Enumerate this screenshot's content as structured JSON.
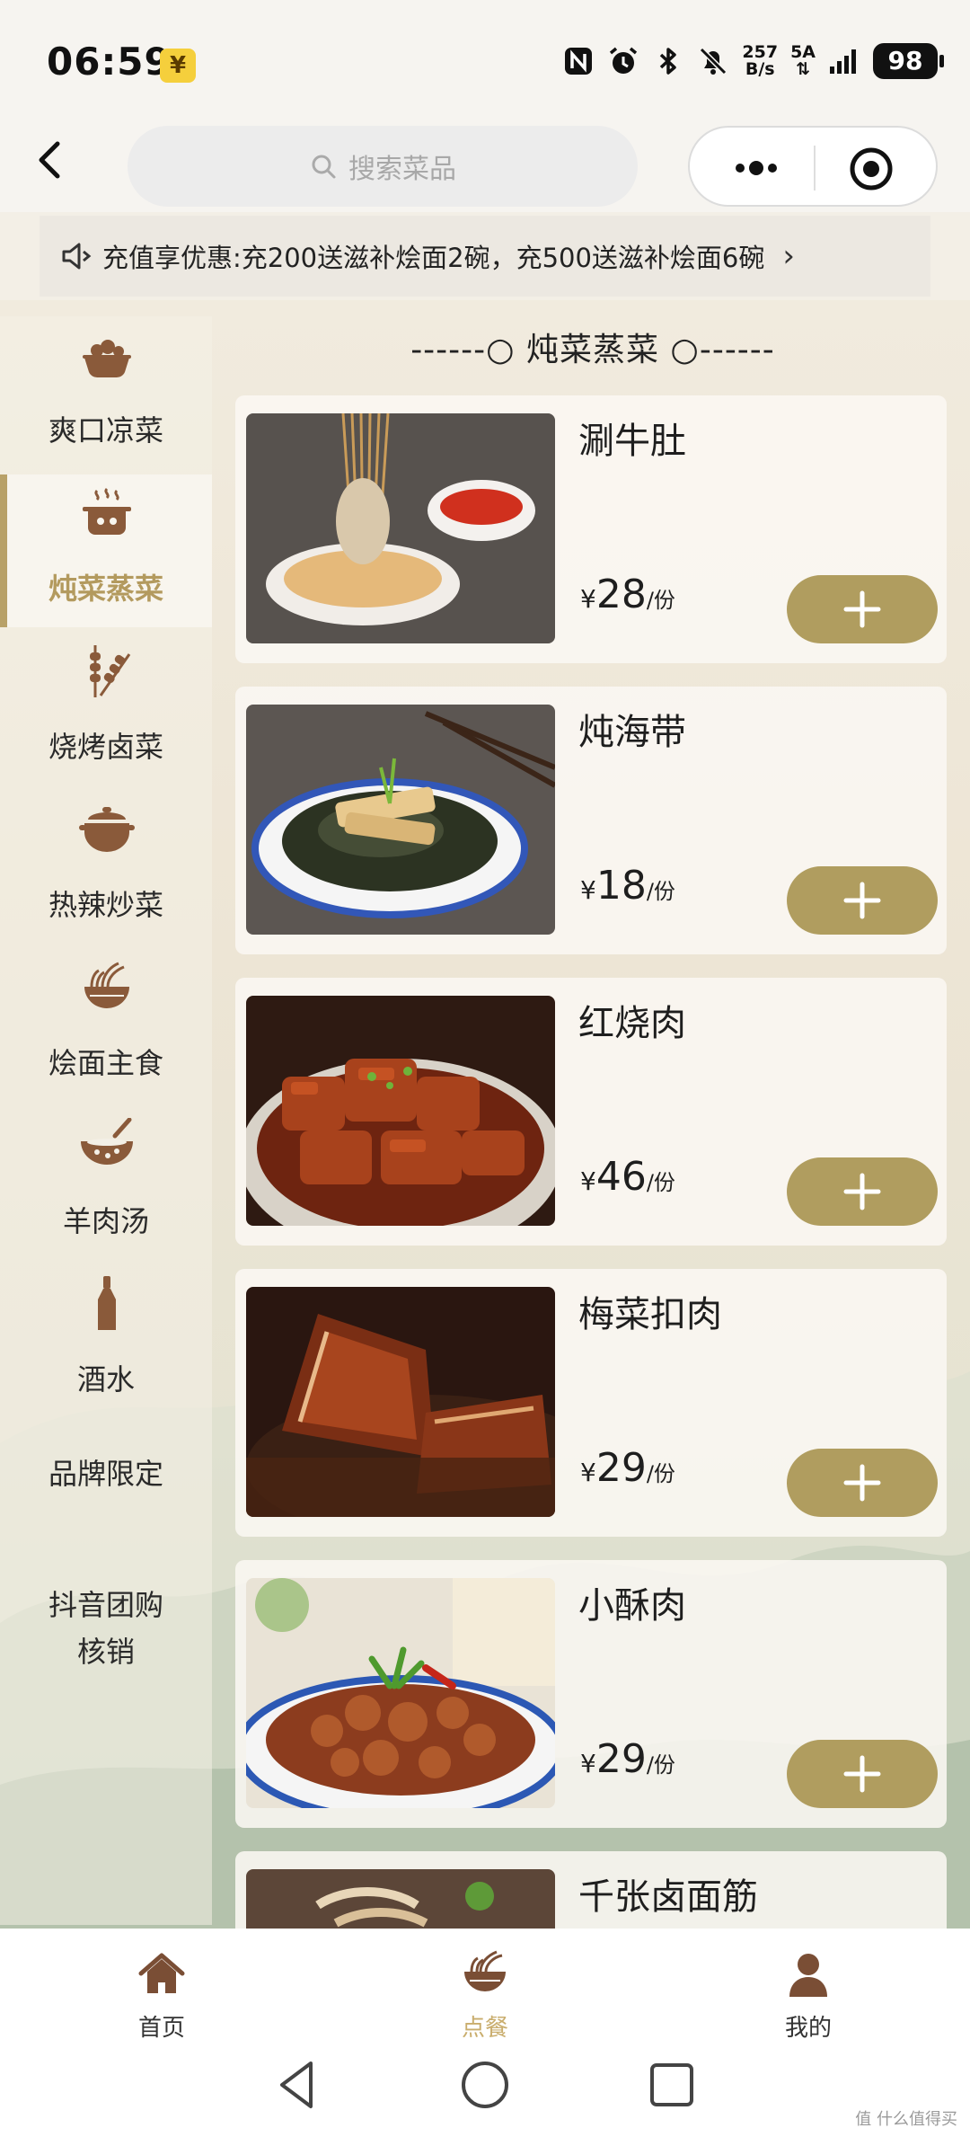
{
  "status_bar": {
    "time": "06:59",
    "badge": "¥",
    "net_speed_value": "257",
    "net_speed_unit": "B/s",
    "network": "5A",
    "battery": "98"
  },
  "nav": {
    "search_placeholder": "搜索菜品"
  },
  "notice": {
    "text": "充值享优惠:充200送滋补烩面2碗，充500送滋补烩面6碗",
    "chevron": "›"
  },
  "sidebar": {
    "items": [
      {
        "label": "爽口凉菜",
        "icon": "cold-dish-icon"
      },
      {
        "label": "炖菜蒸菜",
        "icon": "steam-pot-icon",
        "active": true
      },
      {
        "label": "烧烤卤菜",
        "icon": "skewer-icon"
      },
      {
        "label": "热辣炒菜",
        "icon": "wok-pot-icon"
      },
      {
        "label": "烩面主食",
        "icon": "noodle-bowl-icon"
      },
      {
        "label": "羊肉汤",
        "icon": "soup-bowl-icon"
      },
      {
        "label": "酒水",
        "icon": "bottle-icon"
      },
      {
        "label": "品牌限定"
      },
      {
        "label_line1": "抖音团购",
        "label_line2": "核销"
      }
    ]
  },
  "section": {
    "title": "------○ 炖菜蒸菜 ○------"
  },
  "dishes": [
    {
      "name": "涮牛肚",
      "currency": "¥",
      "price": "28",
      "unit": "/份"
    },
    {
      "name": "炖海带",
      "currency": "¥",
      "price": "18",
      "unit": "/份"
    },
    {
      "name": "红烧肉",
      "currency": "¥",
      "price": "46",
      "unit": "/份"
    },
    {
      "name": "梅菜扣肉",
      "currency": "¥",
      "price": "29",
      "unit": "/份"
    },
    {
      "name": "小酥肉",
      "currency": "¥",
      "price": "29",
      "unit": "/份"
    },
    {
      "name": "千张卤面筋"
    }
  ],
  "tab_bar": {
    "tabs": [
      {
        "label": "首页",
        "icon": "home-icon"
      },
      {
        "label": "点餐",
        "icon": "noodle-bowl-icon",
        "active": true
      },
      {
        "label": "我的",
        "icon": "user-icon"
      }
    ]
  },
  "watermark": "值 什么值得买",
  "colors": {
    "accent": "#b09d5f",
    "accent_text": "#b39a5e",
    "icon_brown": "#8a5a3a"
  }
}
